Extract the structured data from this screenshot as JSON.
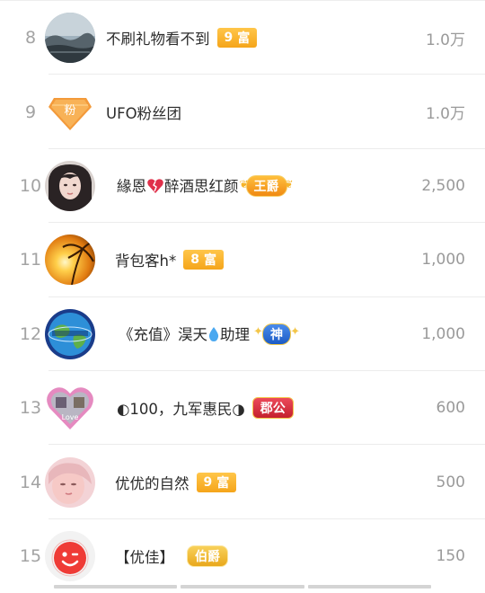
{
  "leaderboard": [
    {
      "rank": "8",
      "name": "不刷礼物看不到",
      "badge": {
        "kind": "level",
        "level": "9",
        "label": "富"
      },
      "amount": "1.0万",
      "avatar": "lake-landscape-avatar"
    },
    {
      "rank": "9",
      "name": "UFO粉丝团",
      "badge": null,
      "amount": "1.0万",
      "avatar": "fan-club-avatar",
      "avatar_label": "粉"
    },
    {
      "rank": "10",
      "name_prefix": "緣恩",
      "name_suffix": "醉酒思红颜",
      "badge": {
        "kind": "title",
        "label": "王爵"
      },
      "amount": "2,500",
      "avatar": "woman-portrait-avatar"
    },
    {
      "rank": "11",
      "name": "背包客h*",
      "badge": {
        "kind": "level",
        "level": "8",
        "label": "富"
      },
      "amount": "1,000",
      "avatar": "sunset-palm-avatar"
    },
    {
      "rank": "12",
      "name_prefix": "《充值》淏天",
      "name_suffix": "助理",
      "badge": {
        "kind": "title",
        "label": "神"
      },
      "amount": "1,000",
      "avatar": "globe-avatar"
    },
    {
      "rank": "13",
      "name": "◐100，九军惠民◑",
      "badge": {
        "kind": "title",
        "label": "郡公"
      },
      "amount": "600",
      "avatar": "love-heart-avatar",
      "avatar_label": "Love"
    },
    {
      "rank": "14",
      "name": "优优的自然",
      "badge": {
        "kind": "level",
        "level": "9",
        "label": "富"
      },
      "amount": "500",
      "avatar": "girl-portrait-avatar"
    },
    {
      "rank": "15",
      "name": "【优佳】",
      "badge": {
        "kind": "title",
        "label": "伯爵"
      },
      "amount": "150",
      "avatar": "red-smiley-avatar"
    }
  ],
  "colors": {
    "level_badge": "#f7b02a",
    "wangjue_badge": "#f79a1a",
    "shen_badge": "#2a6fd6",
    "jungong_badge": "#e03a4a",
    "bojue_badge": "#f3c030"
  }
}
